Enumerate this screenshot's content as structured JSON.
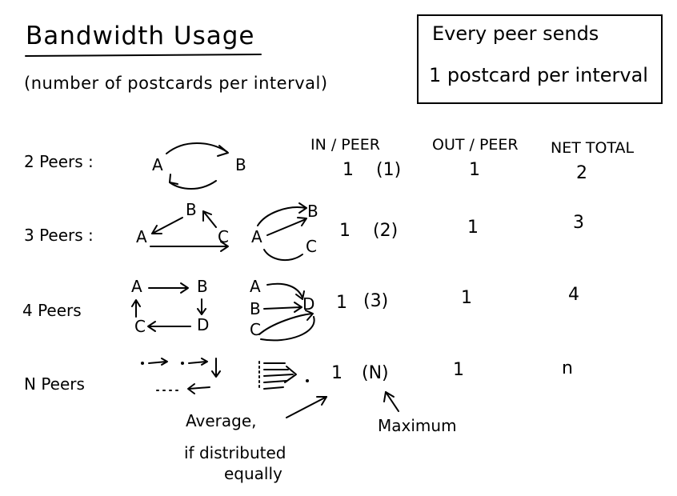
{
  "title": "Bandwidth Usage",
  "subtitle": "(number of postcards per interval)",
  "note": {
    "line1": "Every peer sends",
    "line2": "1 postcard per interval"
  },
  "headers": {
    "in_per_peer": "IN / PEER",
    "out_per_peer": "OUT / PEER",
    "net_total": "NET TOTAL"
  },
  "rows": [
    {
      "label": "2 Peers :",
      "in_avg": "1",
      "in_max": "(1)",
      "out": "1",
      "net": "2"
    },
    {
      "label": "3 Peers :",
      "in_avg": "1",
      "in_max": "(2)",
      "out": "1",
      "net": "3"
    },
    {
      "label": "4 Peers",
      "in_avg": "1",
      "in_max": "(3)",
      "out": "1",
      "net": "4"
    },
    {
      "label": "N Peers",
      "in_avg": "1",
      "in_max": "(N)",
      "out": "1",
      "net": "n"
    }
  ],
  "nodes": {
    "a": "A",
    "b": "B",
    "c": "C",
    "d": "D"
  },
  "annotations": {
    "average": "Average,",
    "if_distributed": "if distributed",
    "equally": "equally",
    "maximum": "Maximum"
  }
}
